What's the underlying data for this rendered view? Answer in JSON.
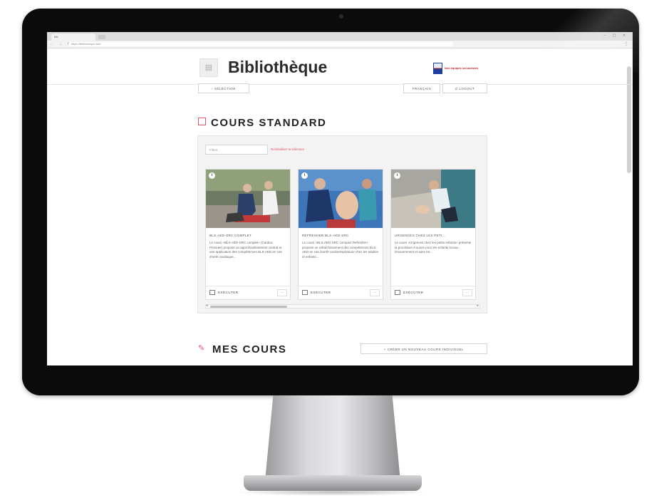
{
  "browser": {
    "tab_label": "Bib",
    "url": "https://bibliotheque.fr/#/",
    "nav_icons": "← → ⟳ ⌂",
    "menu_icon": "⋮",
    "window_controls": "‒ ▢ ✕"
  },
  "header": {
    "logo_icon": "book-icon",
    "title": "Bibliothèque",
    "partner_text": "Nos équipes secouristes"
  },
  "toolbar": {
    "selection_label": "‹  SÉLECTION",
    "language_label": "FRANÇAIS",
    "logout_label": "⏻  LOGOUT"
  },
  "standard": {
    "title": "COURS STANDARD",
    "filter_placeholder": "Filtrer...",
    "reset_label": "Réinitialiser la sélection",
    "cards": [
      {
        "badge": "i",
        "title": "BLS-AED-SRC COMPLET",
        "description": "Le cours «BLS-AED-SRC complet» (Cardiac Provider) propose un approfondissement central et une application des compétences BLS-AED en cas d'arrêt cardiaque...",
        "run_label": "EXÉCUTER",
        "more_label": "···"
      },
      {
        "badge": "i",
        "title": "REFRESHER BLS-AED-SRC",
        "description": "Le cours «BLS-AED-SRC compact Refresher» propose un rafraîchissement des compétences BLS-AED en cas d'arrêt cardiorespiratoire chez les adultes et enfants...",
        "run_label": "EXÉCUTER",
        "more_label": "···"
      },
      {
        "badge": "i",
        "title": "URGENCES CHEZ LES PETI...",
        "description": "Le cours «Urgences chez les petits enfants» présente la procédure à suivre pour les enfants locaux, innocemment et sans rer...",
        "run_label": "EXÉCUTER",
        "more_label": "···"
      }
    ]
  },
  "mine": {
    "title": "MES COURS",
    "create_label": "+   CRÉER UN NOUVEAU COURS INDIVIDUEL"
  },
  "icons": {
    "apple": "",
    "cours_icon": "☰",
    "mes_icon": "✎"
  },
  "colors": {
    "accent": "#e0546a",
    "bezel": "#0b0b0c"
  }
}
